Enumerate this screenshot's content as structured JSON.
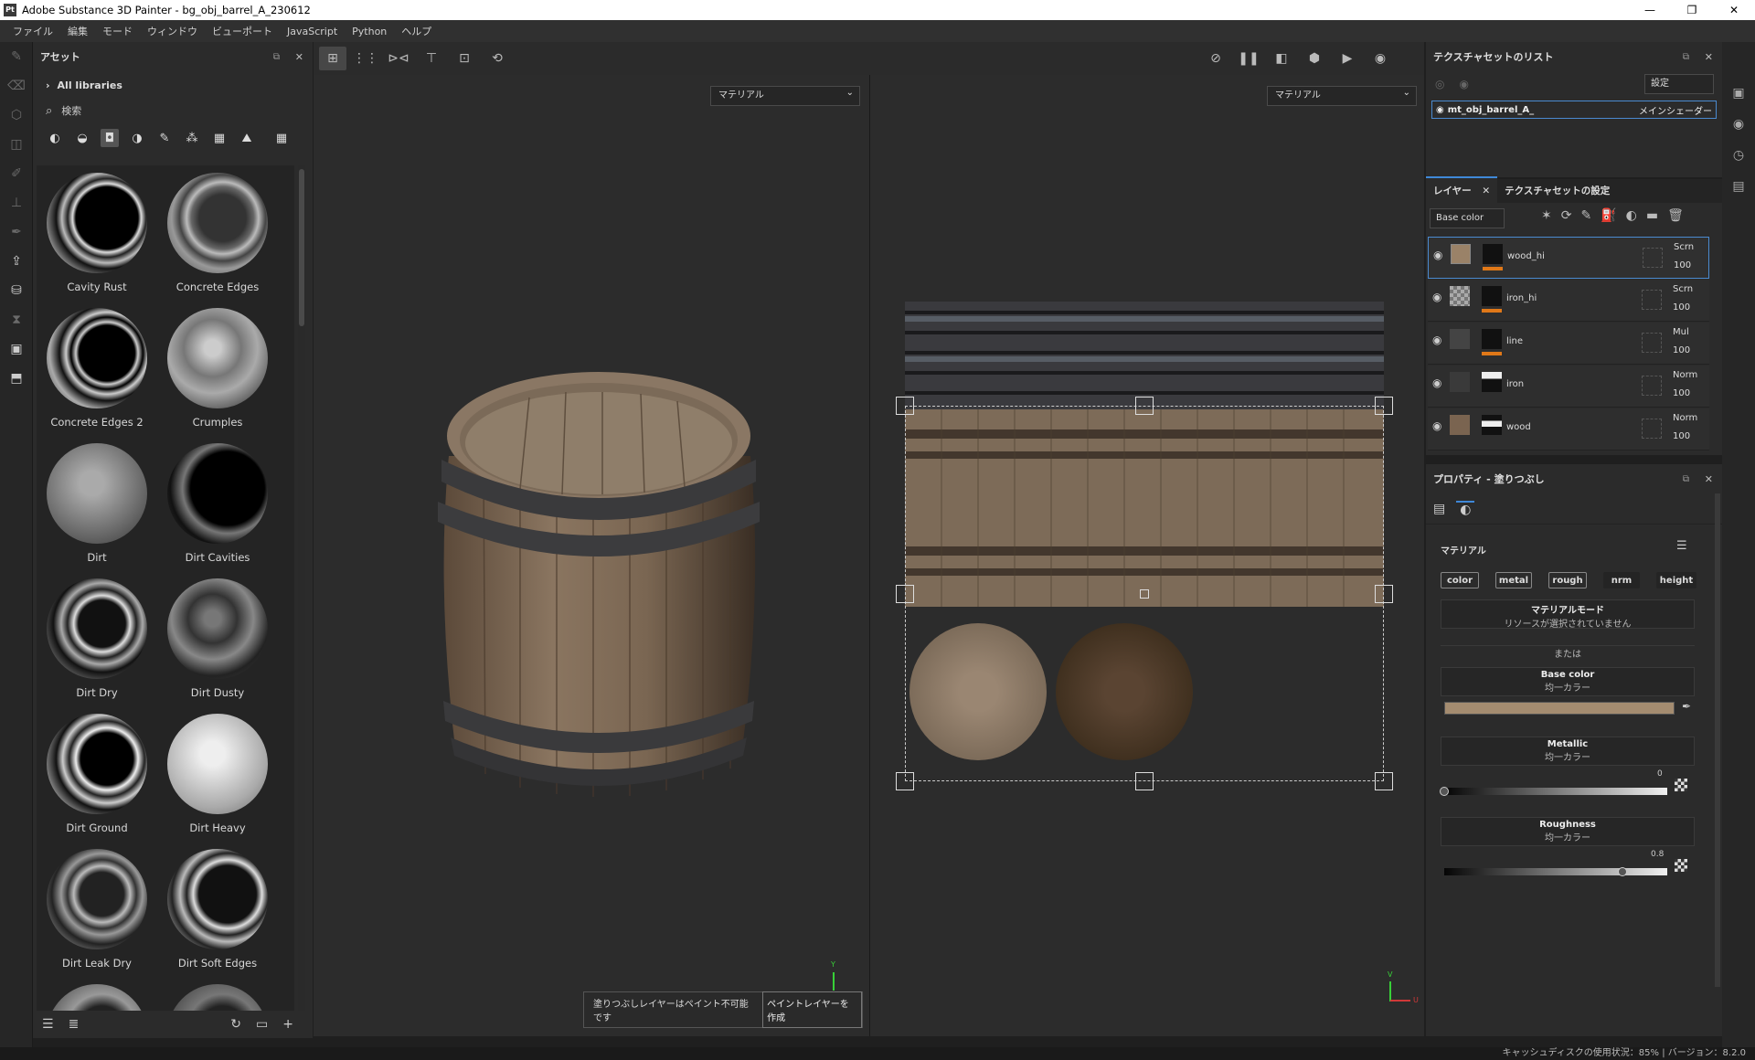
{
  "window": {
    "title": "Adobe Substance 3D Painter - bg_obj_barrel_A_230612",
    "logo": "Pt"
  },
  "menu": [
    "ファイル",
    "編集",
    "モード",
    "ウィンドウ",
    "ビューポート",
    "JavaScript",
    "Python",
    "ヘルプ"
  ],
  "assets": {
    "title": "アセット",
    "library": "All libraries",
    "search_placeholder": "検索",
    "items": [
      "Cavity Rust",
      "Concrete Edges",
      "Concrete Edges 2",
      "Crumples",
      "Dirt",
      "Dirt Cavities",
      "Dirt Dry",
      "Dirt Dusty",
      "Dirt Ground",
      "Dirt Heavy",
      "Dirt Leak Dry",
      "Dirt Soft Edges"
    ]
  },
  "viewport": {
    "left_dropdown": "マテリアル",
    "right_dropdown": "マテリアル",
    "toast_text": "塗りつぶしレイヤーはペイント不可能です",
    "toast_button": "ペイントレイヤーを作成",
    "axis_v": "V",
    "axis_u": "U",
    "axis_y": "Y"
  },
  "texture_sets": {
    "title": "テクスチャセットのリスト",
    "settings": "設定",
    "item_name": "mt_obj_barrel_A_",
    "item_shader": "メインシェーダー"
  },
  "layers": {
    "tab_layers": "レイヤー",
    "tab_ts_settings": "テクスチャセットの設定",
    "channel": "Base color",
    "rows": [
      {
        "name": "wood_hi",
        "blend": "Scrn",
        "opacity": "100"
      },
      {
        "name": "iron_hi",
        "blend": "Scrn",
        "opacity": "100"
      },
      {
        "name": "line",
        "blend": "Mul",
        "opacity": "100"
      },
      {
        "name": "iron",
        "blend": "Norm",
        "opacity": "100"
      },
      {
        "name": "wood",
        "blend": "Norm",
        "opacity": "100"
      }
    ]
  },
  "properties": {
    "title": "プロパティ - 塗りつぶし",
    "section": "マテリアル",
    "chips": [
      "color",
      "metal",
      "rough",
      "nrm",
      "height"
    ],
    "material_mode_title": "マテリアルモード",
    "material_mode_sub": "リソースが選択されていません",
    "or": "または",
    "base_color_title": "Base color",
    "uniform": "均一カラー",
    "base_color_hex": "#a48c70",
    "metallic_title": "Metallic",
    "metallic_value": "0",
    "metallic_level": 0,
    "roughness_title": "Roughness",
    "roughness_value": "0.8",
    "roughness_level": 0.8
  },
  "status": "キャッシュディスクの使用状況：85% | バージョン：8.2.0"
}
